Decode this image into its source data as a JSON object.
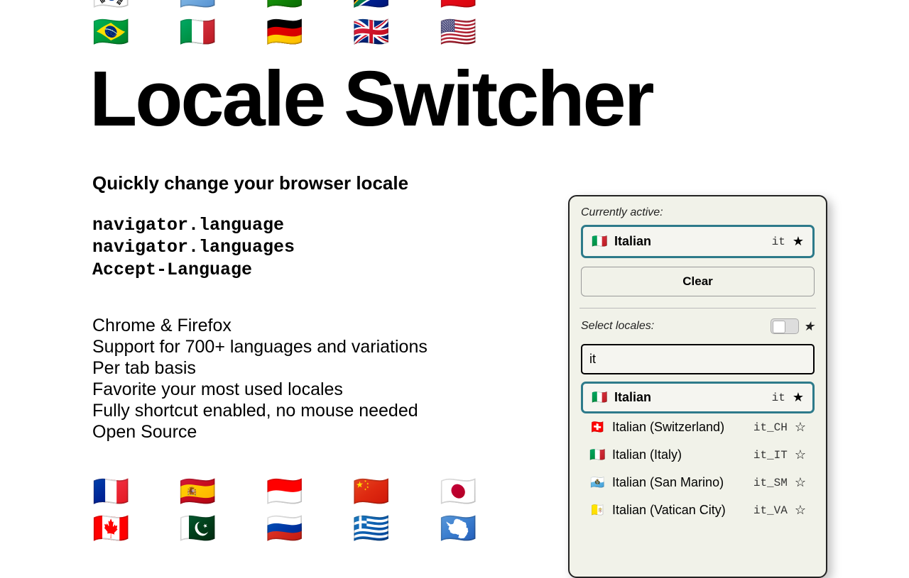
{
  "hero": {
    "title": "Locale Switcher",
    "tagline": "Quickly change your browser locale",
    "code_lines": [
      "navigator.language",
      "navigator.languages",
      "Accept-Language"
    ],
    "features": [
      "Chrome & Firefox",
      "Support for 700+ languages and variations",
      "Per tab basis",
      "Favorite your most used locales",
      "Fully shortcut enabled, no mouse needed",
      "Open Source"
    ],
    "flags_top": [
      [
        "🇰🇷",
        "🇦🇷",
        "🇮🇳",
        "🇿🇦",
        "🇹🇷"
      ],
      [
        "🇧🇷",
        "🇮🇹",
        "🇩🇪",
        "🇬🇧",
        "🇺🇸"
      ]
    ],
    "flags_bottom": [
      [
        "🇫🇷",
        "🇪🇸",
        "🇮🇩",
        "🇨🇳",
        "🇯🇵"
      ],
      [
        "🇨🇦",
        "🇵🇰",
        "🇷🇺",
        "🇬🇷",
        "🇦🇶"
      ]
    ]
  },
  "panel": {
    "label_active": "Currently active:",
    "active": {
      "flag": "🇮🇹",
      "name": "Italian",
      "code": "it",
      "starred": true
    },
    "clear_label": "Clear",
    "label_select": "Select locales:",
    "search_value": "it",
    "results": [
      {
        "flag": "🇮🇹",
        "name": "Italian",
        "code": "it",
        "starred": true,
        "highlight": true
      },
      {
        "flag": "🇨🇭",
        "name": "Italian (Switzerland)",
        "code": "it_CH",
        "starred": false
      },
      {
        "flag": "🇮🇹",
        "name": "Italian (Italy)",
        "code": "it_IT",
        "starred": false
      },
      {
        "flag": "🇸🇲",
        "name": "Italian (San Marino)",
        "code": "it_SM",
        "starred": false
      },
      {
        "flag": "🇻🇦",
        "name": "Italian (Vatican City)",
        "code": "it_VA",
        "starred": false
      }
    ]
  }
}
